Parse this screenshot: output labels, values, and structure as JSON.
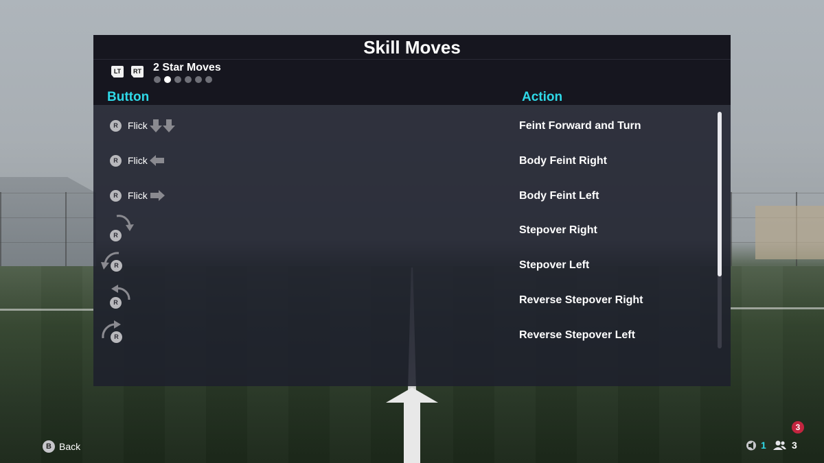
{
  "panel": {
    "title": "Skill Moves",
    "triggers": [
      "LT",
      "RT"
    ],
    "category": "2 Star Moves",
    "pages": {
      "count": 6,
      "active_index": 1
    },
    "columns": {
      "button": "Button",
      "action": "Action"
    },
    "rows": [
      {
        "input": "R",
        "verb": "Flick",
        "gesture": "down-down-arrows",
        "action": "Feint Forward and Turn"
      },
      {
        "input": "R",
        "verb": "Flick",
        "gesture": "left-arrow",
        "action": "Body Feint Right"
      },
      {
        "input": "R",
        "verb": "Flick",
        "gesture": "right-arrow",
        "action": "Body Feint Left"
      },
      {
        "input": "R",
        "verb": "",
        "gesture": "rotate-clockwise",
        "action": "Stepover Right"
      },
      {
        "input": "R",
        "verb": "",
        "gesture": "rotate-counterclockwise",
        "action": "Stepover Left"
      },
      {
        "input": "R",
        "verb": "",
        "gesture": "reverse-rotate-right",
        "action": "Reverse Stepover Right"
      },
      {
        "input": "R",
        "verb": "",
        "gesture": "reverse-rotate-left",
        "action": "Reverse Stepover Left"
      }
    ]
  },
  "footer": {
    "back_badge": "B",
    "back_label": "Back",
    "notification_count": "3",
    "party_count": "1",
    "players_count": "3"
  },
  "colors": {
    "accent": "#2fd9e8",
    "notification": "#c2253f"
  }
}
